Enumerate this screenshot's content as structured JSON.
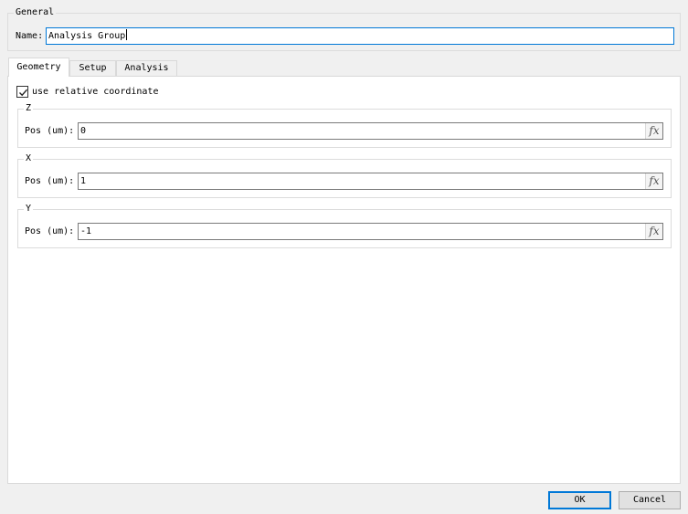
{
  "general": {
    "title": "General",
    "name_label": "Name:",
    "name_value": "Analysis Group"
  },
  "tabs": [
    {
      "label": "Geometry",
      "active": true
    },
    {
      "label": "Setup",
      "active": false
    },
    {
      "label": "Analysis",
      "active": false
    }
  ],
  "geometry": {
    "relative_coord_label": "use relative coordinate",
    "relative_coord_checked": true,
    "axes": [
      {
        "title": "Z",
        "pos_label": "Pos (um):",
        "value": "0",
        "fx": "fx"
      },
      {
        "title": "X",
        "pos_label": "Pos (um):",
        "value": "1",
        "fx": "fx"
      },
      {
        "title": "Y",
        "pos_label": "Pos (um):",
        "value": "-1",
        "fx": "fx"
      }
    ]
  },
  "buttons": {
    "ok": "OK",
    "cancel": "Cancel"
  },
  "colors": {
    "focus_border": "#0078d7",
    "window_bg": "#f0f0f0",
    "panel_bg": "#ffffff"
  },
  "icons": {
    "checkbox": "check-icon",
    "formula": "fx-icon"
  }
}
